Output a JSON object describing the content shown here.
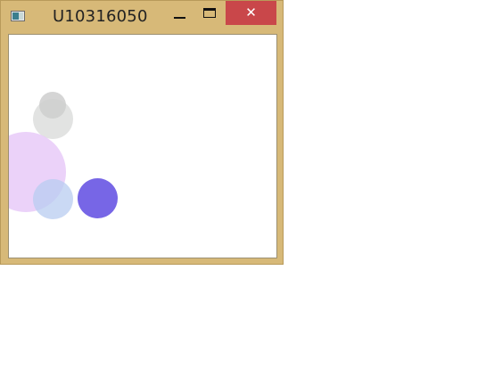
{
  "window": {
    "title": "U10316050",
    "controls": {
      "minimize": "minimize",
      "maximize": "maximize",
      "close_glyph": "✕"
    },
    "icon": "app-window-icon"
  },
  "canvas": {
    "shapes": [
      {
        "name": "gray-small-circle",
        "color": "#b9b9b9",
        "opacity": 0.6
      },
      {
        "name": "gray-large-circle",
        "color": "#cfd1cf",
        "opacity": 0.6
      },
      {
        "name": "pink-circle",
        "color": "#e6c7f7",
        "opacity": 0.8
      },
      {
        "name": "light-blue-circle",
        "color": "#b8ccf0",
        "opacity": 0.75
      },
      {
        "name": "purple-circle",
        "color": "#7766e6",
        "opacity": 1.0
      }
    ]
  }
}
